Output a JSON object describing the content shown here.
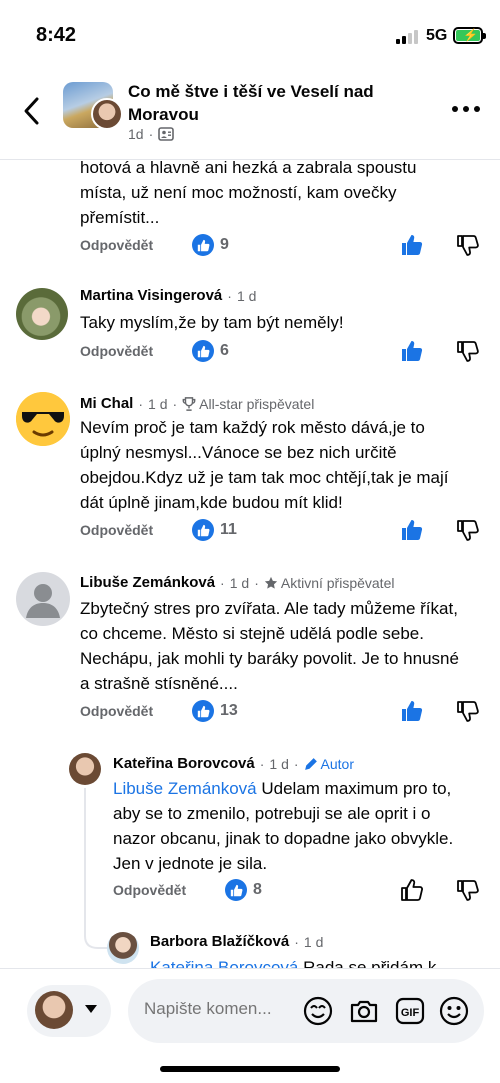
{
  "status": {
    "time": "8:42",
    "network": "5G"
  },
  "header": {
    "group_title": "Co mě štve i těší ve Veselí nad Moravou",
    "meta_time": "1d"
  },
  "labels": {
    "reply": "Odpovědět"
  },
  "comments": [
    {
      "text": "hotová a hlavně ani hezká a zabrala spoustu místa, už není moc možností, kam ovečky přemístit...",
      "likes": "9"
    },
    {
      "name": "Martina Visingerová",
      "time": "1 d",
      "text": "Taky myslím,že by tam být neměly!",
      "likes": "6"
    },
    {
      "name": "Mi Chal",
      "time": "1 d",
      "badge": "All-star přispěvatel",
      "text": "Nevím proč je tam každý rok město dává,je to úplný nesmysl...Vánoce se bez nich určitě obejdou.Kdyz už je tam tak moc chtějí,tak je mají dát úplně jinam,kde budou mít klid!",
      "likes": "11"
    },
    {
      "name": "Libuše Zemánková",
      "time": "1 d",
      "badge": "Aktivní přispěvatel",
      "text": "Zbytečný stres pro zvířata. Ale tady můžeme říkat, co chceme. Město si stejně udělá podle sebe. Nechápu, jak mohli ty baráky povolit. Je to hnusné a strašně stísněné....",
      "likes": "13"
    },
    {
      "name": "Kateřina Borovcová",
      "time": "1 d",
      "badge": "Autor",
      "mention": "Libuše Zemánková",
      "text": " Udelam maximum pro to, aby se to zmenilo, potrebuji se ale oprit i o nazor obcanu, jinak to dopadne jako obvykle. Jen v jednote je sila.",
      "likes": "8"
    },
    {
      "name": "Barbora Blažíčková",
      "time": "1 d",
      "mention": "Kateřina Borovcová",
      "text": " Rada se přidám k"
    }
  ],
  "composer": {
    "placeholder": "Napište komen..."
  },
  "icons": {
    "back": "chevron-left-icon",
    "more": "more-horizontal-icon",
    "like_badge": "thumbs-up-icon",
    "like": "thumbs-up-icon",
    "dislike": "thumbs-down-icon",
    "avatar_sticker": "sticker-icon",
    "camera": "camera-icon",
    "gif": "gif-icon",
    "emoji": "emoji-icon",
    "group_privacy": "members-icon",
    "trophy": "trophy-icon",
    "star": "star-icon",
    "pencil": "pencil-icon"
  },
  "colors": {
    "accent": "#1b74e4",
    "secondary_text": "#65676b",
    "battery": "#34c759"
  }
}
